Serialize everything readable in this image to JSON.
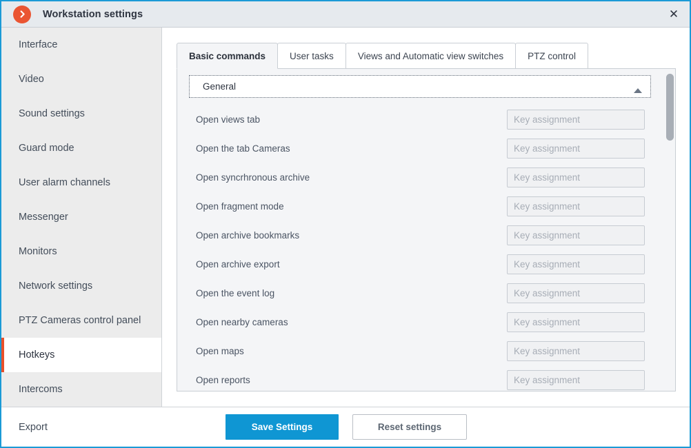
{
  "window": {
    "title": "Workstation settings",
    "app_icon": "chevron-right-circle-icon",
    "close_label": "✕",
    "accent_color": "#1b9ad6",
    "brand_color": "#ea5532"
  },
  "sidebar": {
    "items": [
      {
        "label": "Interface",
        "selected": false
      },
      {
        "label": "Video",
        "selected": false
      },
      {
        "label": "Sound settings",
        "selected": false
      },
      {
        "label": "Guard mode",
        "selected": false
      },
      {
        "label": "User alarm channels",
        "selected": false
      },
      {
        "label": "Messenger",
        "selected": false
      },
      {
        "label": "Monitors",
        "selected": false
      },
      {
        "label": "Network settings",
        "selected": false
      },
      {
        "label": "PTZ Cameras control panel",
        "selected": false
      },
      {
        "label": "Hotkeys",
        "selected": true
      },
      {
        "label": "Intercoms",
        "selected": false
      }
    ],
    "selected_accent": "#e8502a",
    "export_label": "Export"
  },
  "tabs": [
    {
      "label": "Basic commands",
      "active": true
    },
    {
      "label": "User tasks",
      "active": false
    },
    {
      "label": "Views and Automatic view switches",
      "active": false
    },
    {
      "label": "PTZ control",
      "active": false
    }
  ],
  "group": {
    "title": "General",
    "expanded": true,
    "arrow": "triangle-up-icon"
  },
  "commands": {
    "key_placeholder": "Key assignment",
    "rows": [
      {
        "label": "Open views tab",
        "value": ""
      },
      {
        "label": "Open the tab Cameras",
        "value": ""
      },
      {
        "label": "Open syncrhronous archive",
        "value": ""
      },
      {
        "label": "Open fragment mode",
        "value": ""
      },
      {
        "label": "Open archive bookmarks",
        "value": ""
      },
      {
        "label": "Open archive export",
        "value": ""
      },
      {
        "label": "Open the event log",
        "value": ""
      },
      {
        "label": "Open nearby cameras",
        "value": ""
      },
      {
        "label": "Open maps",
        "value": ""
      },
      {
        "label": "Open reports",
        "value": ""
      }
    ]
  },
  "footer": {
    "save_label": "Save Settings",
    "reset_label": "Reset settings",
    "save_color": "#0f96d3"
  }
}
